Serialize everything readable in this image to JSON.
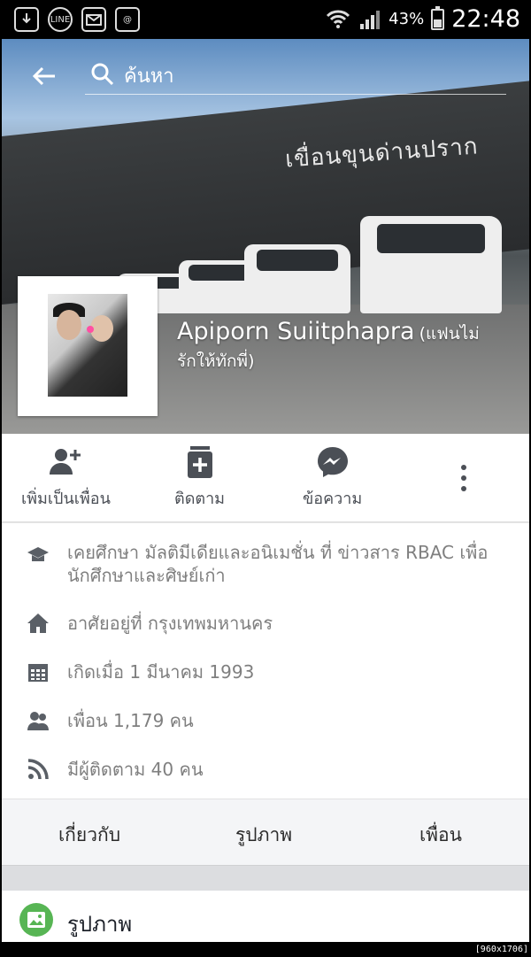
{
  "status_bar": {
    "notification_icons": [
      "download-icon",
      "line-icon",
      "mail-icon",
      "at-icon"
    ],
    "battery_percent": "43%",
    "battery_level": 0.43,
    "time": "22:48"
  },
  "search": {
    "placeholder": "ค้นหา"
  },
  "cover": {
    "sign_text": "เขื่อนขุนด่านปราก"
  },
  "profile": {
    "name": "Apiporn Suiitphapra",
    "nickname_line1": "(แฟนไม่",
    "nickname_line2": "รักให้ทักพี่)"
  },
  "actions": [
    {
      "label": "เพิ่มเป็นเพื่อน",
      "icon": "add-friend-icon"
    },
    {
      "label": "ติดตาม",
      "icon": "follow-icon"
    },
    {
      "label": "ข้อความ",
      "icon": "messenger-icon"
    }
  ],
  "info": [
    {
      "icon": "education-icon",
      "line1": "เคยศึกษา มัลติมีเดียและอนิเมชั่น ที่ ข่าวสาร RBAC เพื่อ",
      "line2": "นักศึกษาและศิษย์เก่า"
    },
    {
      "icon": "home-icon",
      "line1": "อาศัยอยู่ที่ กรุงเทพมหานคร"
    },
    {
      "icon": "calendar-icon",
      "line1": "เกิดเมื่อ 1 มีนาคม 1993"
    },
    {
      "icon": "friends-icon",
      "line1": "เพื่อน 1,179 คน"
    },
    {
      "icon": "rss-icon",
      "line1": "มีผู้ติดตาม 40 คน"
    }
  ],
  "tabs": [
    "เกี่ยวกับ",
    "รูปภาพ",
    "เพื่อน"
  ],
  "photos_section": {
    "title": "รูปภาพ"
  },
  "watermark": "[960x1706] https://upic.me/"
}
